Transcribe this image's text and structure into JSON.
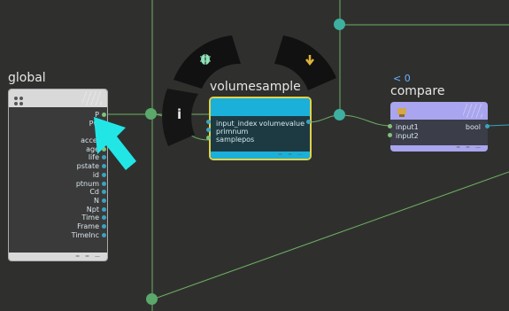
{
  "graph": {
    "global": {
      "title": "global",
      "outputs": [
        "P",
        "Pw",
        "v",
        "accel",
        "age",
        "life",
        "pstate",
        "id",
        "ptnum",
        "Cd",
        "N",
        "Npt",
        "Time",
        "Frame",
        "TimeInc"
      ]
    },
    "volumesample": {
      "title": "volumesample",
      "inputs": [
        "input_index",
        "primnum",
        "samplepos"
      ],
      "output": "volumevalue"
    },
    "compare": {
      "title": "compare",
      "condition": "< 0",
      "inputs": [
        "input1",
        "input2"
      ],
      "output": "bool"
    },
    "ring_menu": {
      "info_icon": "info-icon",
      "debug_icon": "bug-icon",
      "bypass_icon": "arrow-down-icon"
    }
  },
  "colors": {
    "background": "#2f302e",
    "wire": "#7fc27a",
    "dot": "#5aa86a",
    "teal_dot": "#3db0a0",
    "vs_header": "#1ab0da",
    "compare_header": "#a9a5ee",
    "selection": "#e1d14a",
    "pointer": "#22e6e6"
  }
}
